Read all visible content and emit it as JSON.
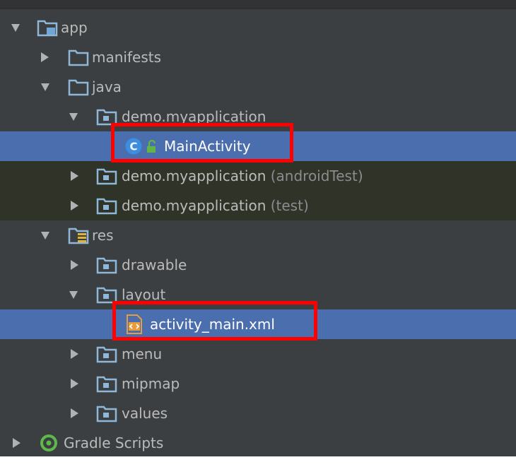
{
  "project_tree": {
    "rows": [
      {
        "label": "app",
        "suffix": ""
      },
      {
        "label": "manifests",
        "suffix": ""
      },
      {
        "label": "java",
        "suffix": ""
      },
      {
        "label": "demo.myapplication",
        "suffix": ""
      },
      {
        "label": "MainActivity",
        "suffix": ""
      },
      {
        "label": "demo.myapplication",
        "suffix": " (androidTest)"
      },
      {
        "label": "demo.myapplication",
        "suffix": " (test)"
      },
      {
        "label": "res",
        "suffix": ""
      },
      {
        "label": "drawable",
        "suffix": ""
      },
      {
        "label": "layout",
        "suffix": ""
      },
      {
        "label": "activity_main.xml",
        "suffix": ""
      },
      {
        "label": "menu",
        "suffix": ""
      },
      {
        "label": "mipmap",
        "suffix": ""
      },
      {
        "label": "values",
        "suffix": ""
      },
      {
        "label": "Gradle Scripts",
        "suffix": ""
      }
    ],
    "class_icon_letter": "C"
  },
  "colors": {
    "panel_bg": "#3c3f41",
    "selection": "#4b6eaf",
    "test_row_bg": "#2f3328",
    "highlight": "#ff0000",
    "folder_blue": "#8fb7d9",
    "module_blue": "#6fa7d6",
    "res_yellow": "#e0b33a",
    "class_blue": "#3d8ee0",
    "xml_orange": "#e89d3c",
    "gradle_green": "#5fb84a"
  }
}
